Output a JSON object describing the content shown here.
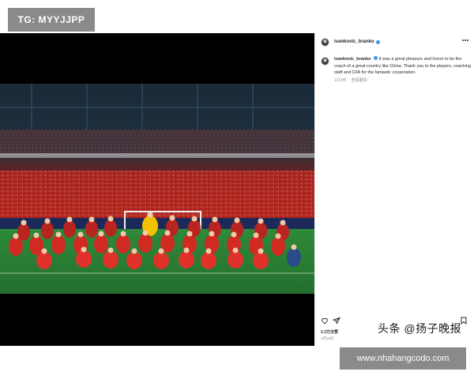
{
  "overlays": {
    "tg_badge": "TG: MYYJJPP",
    "source_watermark": "头条 @扬子晚报",
    "url_badge": "www.nhahangcodo.com"
  },
  "post": {
    "header": {
      "username": "ivankovic_branko",
      "avatar_icon": "avatar",
      "verified_icon": "verified-badge-icon",
      "more_icon": "more-options-icon"
    },
    "caption": {
      "username": "ivankovic_branko",
      "text": "It was a great pleasure and honor to be the coach of a great country like China. Thank you to the players, coaching staff and CFA for the fantastic cooperation.",
      "time_ago": "12小时",
      "translate_label": "查看翻译"
    },
    "actions": {
      "like_icon": "heart-icon",
      "share_icon": "send-icon",
      "save_icon": "bookmark-icon"
    },
    "likes": "2.3万次赞",
    "date": "1月16日"
  },
  "colors": {
    "badge_bg": "#8a8a8a",
    "pitch": "#2f8a3a",
    "stands": "#b8231f",
    "jersey": "#c8201d",
    "keeper": "#f2c200",
    "verified": "#3897f0"
  }
}
